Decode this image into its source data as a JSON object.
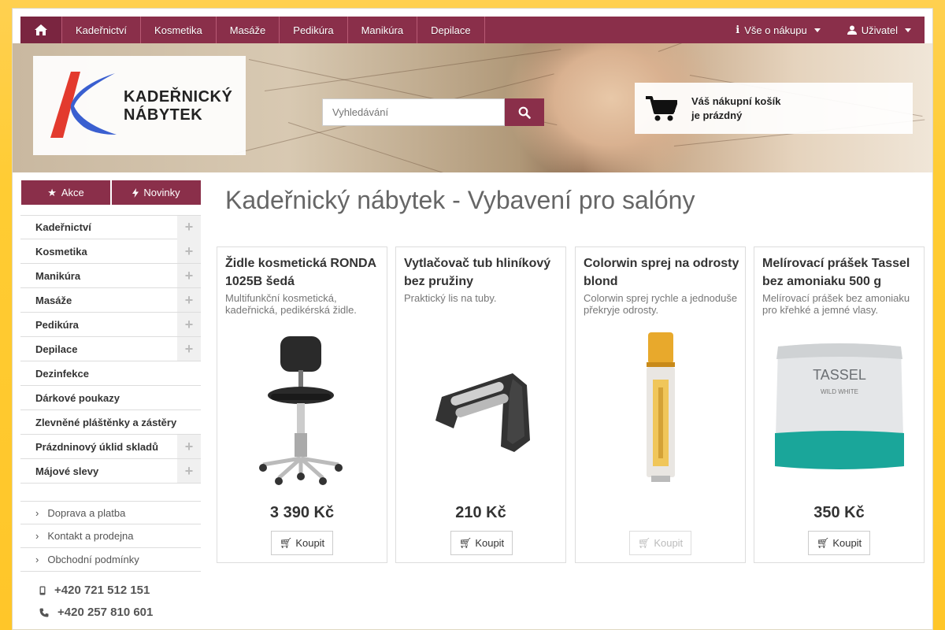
{
  "nav": {
    "items": [
      "Kadeřnictví",
      "Kosmetika",
      "Masáže",
      "Pedikúra",
      "Manikúra",
      "Depilace"
    ],
    "shopping_info": "Vše o nákupu",
    "user": "Uživatel"
  },
  "logo": {
    "line1": "KADEŘNICKÝ",
    "line2": "NÁBYTEK"
  },
  "search": {
    "placeholder": "Vyhledávání"
  },
  "cart": {
    "line1": "Váš nákupní košík",
    "line2": "je prázdný"
  },
  "sidebar": {
    "tabs": [
      {
        "label": "Akce",
        "icon": "star-icon"
      },
      {
        "label": "Novinky",
        "icon": "bolt-icon"
      }
    ],
    "categories": [
      {
        "label": "Kadeřnictví",
        "expandable": true
      },
      {
        "label": "Kosmetika",
        "expandable": true
      },
      {
        "label": "Manikúra",
        "expandable": true
      },
      {
        "label": "Masáže",
        "expandable": true
      },
      {
        "label": "Pedikúra",
        "expandable": true
      },
      {
        "label": "Depilace",
        "expandable": true
      },
      {
        "label": "Dezinfekce",
        "expandable": false
      },
      {
        "label": "Dárkové poukazy",
        "expandable": false
      },
      {
        "label": "Zlevněné pláštěnky a zástěry",
        "expandable": false
      },
      {
        "label": "Prázdninový úklid skladů",
        "expandable": true
      },
      {
        "label": "Májové slevy",
        "expandable": true
      }
    ],
    "info_links": [
      "Doprava a platba",
      "Kontakt a prodejna",
      "Obchodní podmínky"
    ],
    "phones": [
      "+420 721 512 151",
      "+420 257 810 601"
    ]
  },
  "main": {
    "title": "Kadeřnický nábytek - Vybavení pro salóny",
    "products": [
      {
        "name": "Židle kosmetická RONDA 1025B šedá",
        "desc": "Multifunkční kosmetická, kadeřnická, pedikérská židle.",
        "price": "3 390 Kč",
        "buy": "Koupit",
        "available": true
      },
      {
        "name": "Vytlačovač tub hliníkový bez pružiny",
        "desc": "Praktický lis na tuby.",
        "price": "210 Kč",
        "buy": "Koupit",
        "available": true
      },
      {
        "name": "Colorwin sprej na odrosty blond",
        "desc": "Colorwin sprej rychle a jednoduše překryje odrosty.",
        "price": "",
        "buy": "Koupit",
        "available": false
      },
      {
        "name": "Melírovací prášek Tassel bez amoniaku 500 g",
        "desc": "Melírovací prášek bez amoniaku pro křehké a jemné vlasy.",
        "price": "350 Kč",
        "buy": "Koupit",
        "available": true
      }
    ]
  },
  "product_image_text": {
    "tassel_brand": "TASSEL",
    "tassel_sub": "WILD WHITE"
  },
  "colors": {
    "brand": "#8a2f4a",
    "background": "#ffcc33"
  }
}
